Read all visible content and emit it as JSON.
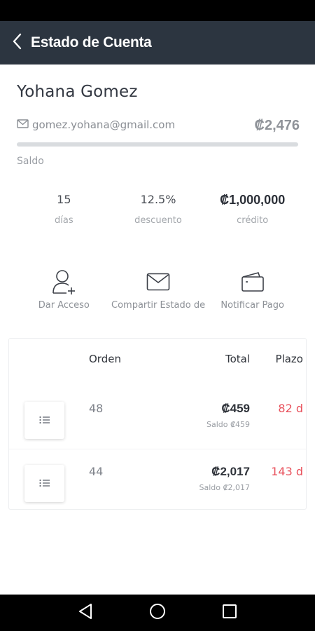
{
  "header": {
    "title": "Estado de Cuenta",
    "back_icon": "chevron-left-icon"
  },
  "profile": {
    "name": "Yohana Gomez",
    "email": "gomez.yohana@gmail.com",
    "balance": "₡2,476",
    "balance_label": "Saldo",
    "balance_progress_fraction": 1.0
  },
  "stats": [
    {
      "value": "15",
      "label": "días"
    },
    {
      "value": "12.5%",
      "label": "descuento"
    },
    {
      "value": "₡1,000,000",
      "label": "crédito"
    }
  ],
  "actions": [
    {
      "label": "Dar Acceso",
      "icon": "add-user-icon"
    },
    {
      "label": "Compartir Estado de Cuenta",
      "icon": "mail-icon"
    },
    {
      "label": "Notificar Pago",
      "icon": "wallet-icon"
    }
  ],
  "orders": {
    "columns": {
      "order": "Orden",
      "total": "Total",
      "term": "Plazo"
    },
    "rows": [
      {
        "order": "48",
        "total": "₡459",
        "saldo": "Saldo ₡459",
        "term": "82 d"
      },
      {
        "order": "44",
        "total": "₡2,017",
        "saldo": "Saldo ₡2,017",
        "term": "143 d"
      }
    ]
  },
  "colors": {
    "app_bar": "#2c3540",
    "term_red": "#e8505b"
  }
}
